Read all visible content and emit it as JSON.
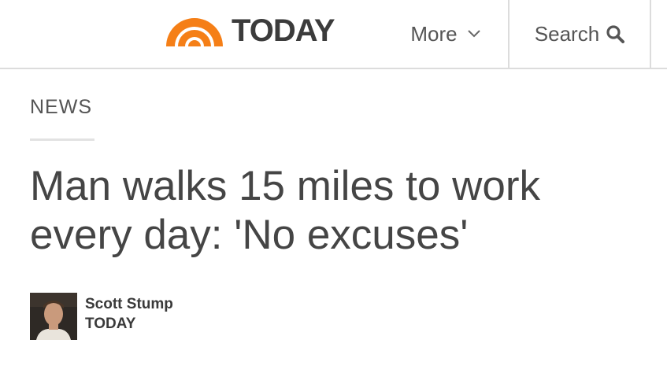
{
  "header": {
    "logo_text": "TODAY",
    "more_label": "More",
    "search_label": "Search"
  },
  "article": {
    "section": "NEWS",
    "headline": "Man walks 15 miles to work every day: 'No excuses'",
    "author": "Scott Stump",
    "outlet": "TODAY"
  },
  "icons": {
    "logo": "today-rainbow-logo",
    "more": "chevron-down-icon",
    "search": "magnifier-icon"
  },
  "colors": {
    "brand_orange": "#f57f17",
    "text_dark": "#454545",
    "divider": "#dcdcdc"
  }
}
